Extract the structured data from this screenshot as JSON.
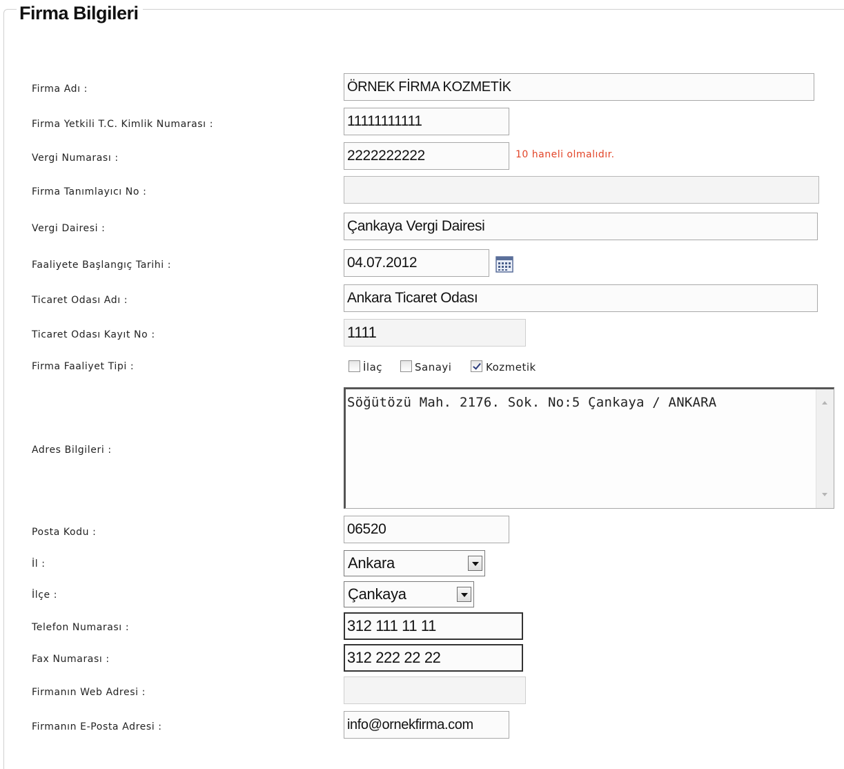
{
  "section_title": "Firma Bilgileri",
  "fields": {
    "firma_adi": {
      "label": "Firma Adı :",
      "value": "ÖRNEK FİRMA KOZMETİK"
    },
    "tc_kimlik": {
      "label": "Firma Yetkili T.C. Kimlik Numarası :",
      "value": "11111111111"
    },
    "vergi_no": {
      "label": "Vergi Numarası :",
      "value": "2222222222",
      "validation": "10 haneli olmalıdır."
    },
    "tanimlayici_no": {
      "label": "Firma Tanımlayıcı No :",
      "value": ""
    },
    "vergi_dairesi": {
      "label": "Vergi Dairesi :",
      "value": "Çankaya Vergi Dairesi"
    },
    "baslangic_tarihi": {
      "label": "Faaliyete Başlangıç Tarihi :",
      "value": "04.07.2012",
      "icon": "calendar-icon"
    },
    "ticaret_odasi": {
      "label": "Ticaret Odası Adı :",
      "value": "Ankara Ticaret Odası"
    },
    "ticaret_kayit": {
      "label": "Ticaret Odası Kayıt No :",
      "value": "1111"
    },
    "faaliyet_tipi": {
      "label": "Firma Faaliyet Tipi :",
      "options": [
        {
          "label": "İlaç",
          "checked": false
        },
        {
          "label": "Sanayi",
          "checked": false
        },
        {
          "label": "Kozmetik",
          "checked": true
        }
      ]
    },
    "adres": {
      "label": "Adres Bilgileri :",
      "value": "Söğütözü Mah. 2176. Sok. No:5 Çankaya / ANKARA"
    },
    "posta_kodu": {
      "label": "Posta Kodu :",
      "value": "06520"
    },
    "il": {
      "label": "İl :",
      "value": "Ankara"
    },
    "ilce": {
      "label": "İlçe :",
      "value": "Çankaya"
    },
    "telefon": {
      "label": "Telefon Numarası :",
      "value": "312 111 11 11"
    },
    "fax": {
      "label": "Fax Numarası :",
      "value": "312 222 22 22"
    },
    "web": {
      "label": "Firmanın Web Adresi :",
      "value": ""
    },
    "eposta": {
      "label": "Firmanın E-Posta Adresi :",
      "value": "info@ornekfirma.com"
    }
  },
  "colors": {
    "validation": "#e24428",
    "border": "#a8a8a8"
  }
}
